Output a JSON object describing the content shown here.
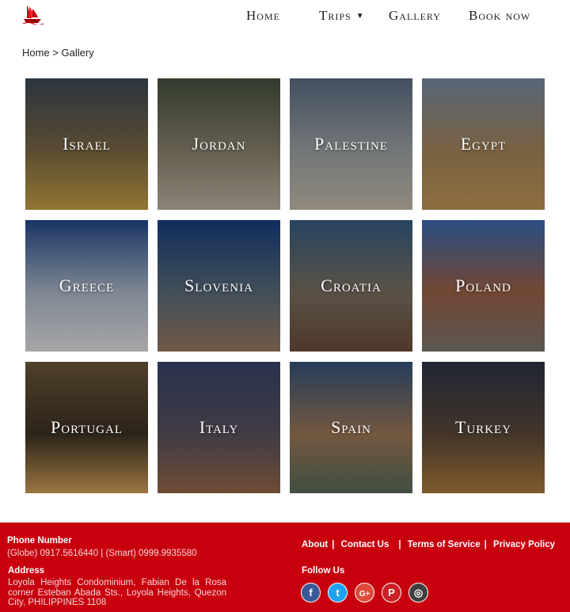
{
  "nav": {
    "home": "Home",
    "trips": "Trips",
    "gallery": "Gallery",
    "book": "Book now"
  },
  "breadcrumb": {
    "home": "Home",
    "separator": ">",
    "current": "Gallery"
  },
  "gallery": [
    {
      "label": "Israel",
      "colors": [
        "#3d4a58",
        "#7d6a45",
        "#c9a345"
      ]
    },
    {
      "label": "Jordan",
      "colors": [
        "#47523f",
        "#8d8470",
        "#c2b9a6"
      ]
    },
    {
      "label": "Palestine",
      "colors": [
        "#5d6f86",
        "#9fa5a6",
        "#c9bfae"
      ]
    },
    {
      "label": "Egypt",
      "colors": [
        "#7b8da7",
        "#a7875b",
        "#c49a58"
      ]
    },
    {
      "label": "Greece",
      "colors": [
        "#234a8e",
        "#b0bccd",
        "#e7e7e7"
      ]
    },
    {
      "label": "Slovenia",
      "colors": [
        "#173f84",
        "#5c6e7c",
        "#9b7b62"
      ]
    },
    {
      "label": "Croatia",
      "colors": [
        "#355f85",
        "#7d7161",
        "#6e4e3d"
      ]
    },
    {
      "label": "Poland",
      "colors": [
        "#3e6bb6",
        "#9e6347",
        "#7e7a72"
      ]
    },
    {
      "label": "Portugal",
      "colors": [
        "#6f5a3d",
        "#3e3223",
        "#d7a35a"
      ]
    },
    {
      "label": "Italy",
      "colors": [
        "#39466d",
        "#5c5260",
        "#9b6a4a"
      ]
    },
    {
      "label": "Spain",
      "colors": [
        "#34557d",
        "#a17a58",
        "#5a6d5a"
      ]
    },
    {
      "label": "Turkey",
      "colors": [
        "#2f3448",
        "#5d4a3a",
        "#b07e3c"
      ]
    }
  ],
  "footer": {
    "phone_heading": "Phone Number",
    "phone_text": "(Globe) 0917.5616440 | (Smart) 0999.9935580",
    "address_heading": "Address",
    "address_text": "Loyola Heights Condominium, Fabian De la Rosa corner Esteban Abada Sts., Loyola Heights, Quezon City, PHILIPPINES 1108",
    "links": {
      "about": "About",
      "contact": "Contact Us",
      "terms": "Terms of Service",
      "privacy": "Privacy Policy",
      "sep": "|"
    },
    "follow_heading": "Follow Us",
    "socials": [
      {
        "icon": "facebook-icon",
        "color": "#3b5998",
        "glyph": "f"
      },
      {
        "icon": "twitter-icon",
        "color": "#1da1f2",
        "glyph": "t"
      },
      {
        "icon": "google-plus-icon",
        "color": "#dd4b39",
        "glyph": "G+"
      },
      {
        "icon": "pinterest-icon",
        "color": "#cb2027",
        "glyph": "P"
      },
      {
        "icon": "instagram-icon",
        "color": "#3f3f3f",
        "glyph": "◎"
      }
    ]
  },
  "colors": {
    "footer_bg": "#c8000e",
    "logo_red": "#c8000e"
  }
}
